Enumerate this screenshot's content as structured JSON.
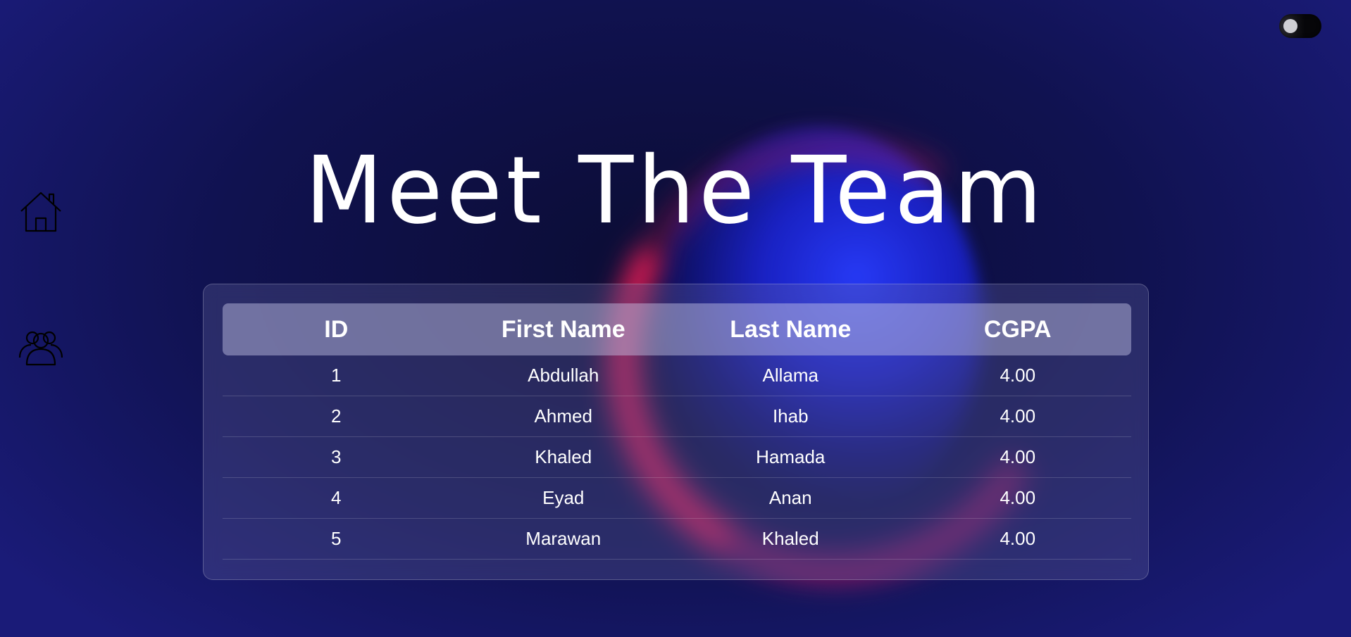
{
  "title": "Meet The Team",
  "theme_toggle": {
    "state": "off"
  },
  "nav": {
    "items": [
      {
        "icon": "home-icon"
      },
      {
        "icon": "team-icon"
      }
    ]
  },
  "table": {
    "headers": [
      "ID",
      "First Name",
      "Last Name",
      "CGPA"
    ],
    "rows": [
      [
        "1",
        "Abdullah",
        "Allama",
        "4.00"
      ],
      [
        "2",
        "Ahmed",
        "Ihab",
        "4.00"
      ],
      [
        "3",
        "Khaled",
        "Hamada",
        "4.00"
      ],
      [
        "4",
        "Eyad",
        "Anan",
        "4.00"
      ],
      [
        "5",
        "Marawan",
        "Khaled",
        "4.00"
      ]
    ]
  },
  "colors": {
    "background": "#101250",
    "glow_blue": "#1e28f0",
    "glow_pink": "#ff1e5a",
    "text": "#ffffff"
  }
}
